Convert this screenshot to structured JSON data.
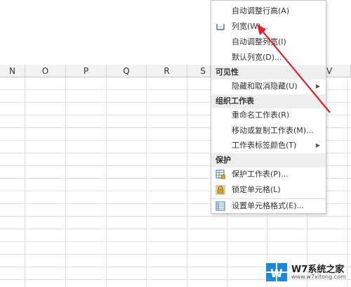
{
  "columns": [
    "N",
    "O",
    "P",
    "Q",
    "R",
    "S",
    "V"
  ],
  "menu": {
    "items_top": [
      {
        "label": "自动调整行高(A)"
      },
      {
        "label": "列宽(W)..."
      },
      {
        "label": "自动调整列宽(I)"
      },
      {
        "label": "默认列宽(D)..."
      }
    ],
    "section_visibility": "可见性",
    "hide_unhide": "隐藏和取消隐藏(U)",
    "section_organize": "组织工作表",
    "rename_sheet": "重命名工作表(R)",
    "move_copy_sheet": "移动或复制工作表(M)...",
    "tab_color": "工作表标签颜色(T)",
    "section_protect": "保护",
    "protect_sheet": "保护工作表(P)...",
    "lock_cell": "锁定单元格(L)",
    "format_cells": "设置单元格格式(E)..."
  },
  "watermark": {
    "brand": "W7系统之家",
    "url": "www.w7xitong.com"
  },
  "colors": {
    "arrow": "#e0202a",
    "icon_blue": "#3a6fb0",
    "lock_gold": "#d9a21b"
  }
}
